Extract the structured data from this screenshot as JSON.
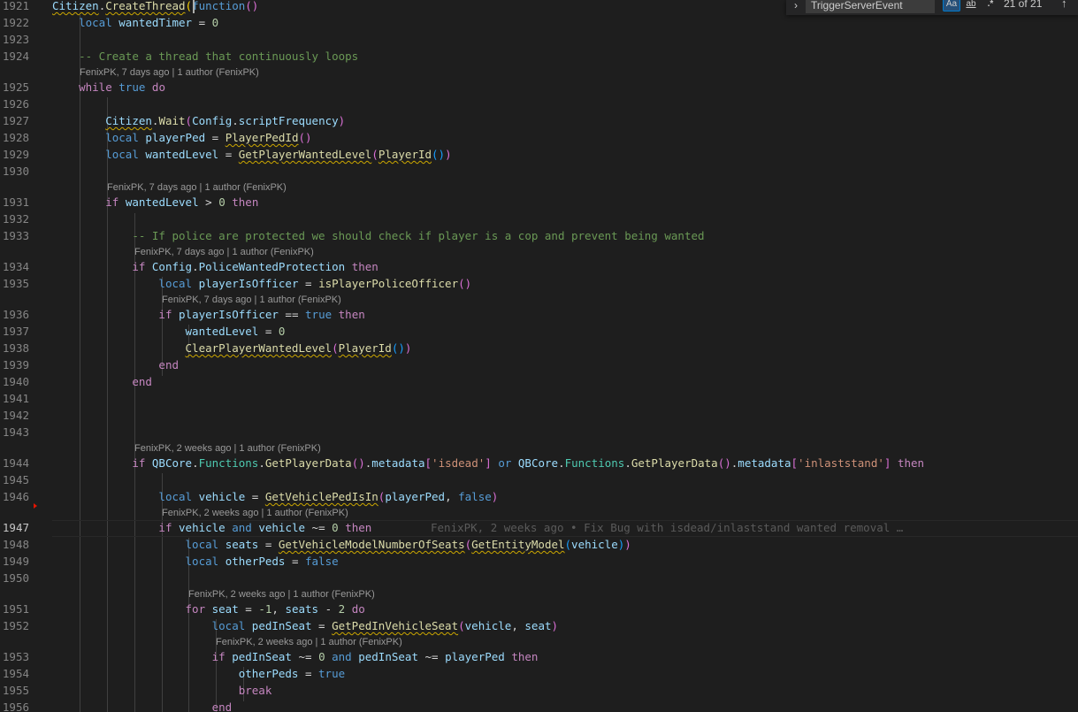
{
  "find_widget": {
    "toggle_icon": "chevron-right-icon",
    "query": "TriggerServerEvent",
    "match_case_label": "Aa",
    "whole_word_label": "ab",
    "regex_label": ".*",
    "count": "21 of 21",
    "prev_icon": "arrow-up-icon"
  },
  "code_lens": [
    "FenixPK, 7 days ago | 1 author (FenixPK)",
    "FenixPK, 7 days ago | 1 author (FenixPK)",
    "FenixPK, 7 days ago | 1 author (FenixPK)",
    "FenixPK, 7 days ago | 1 author (FenixPK)",
    "FenixPK, 2 weeks ago | 1 author (FenixPK)",
    "FenixPK, 2 weeks ago | 1 author (FenixPK)",
    "FenixPK, 2 weeks ago | 1 author (FenixPK)",
    "FenixPK, 2 weeks ago | 1 author (FenixPK)"
  ],
  "inline_blame": "FenixPK, 2 weeks ago • Fix Bug with isdead/inlaststand wanted removal …",
  "current_line": "1947",
  "lines": [
    {
      "n": "1921",
      "tokens": [
        [
          "Citizen",
          "var squig"
        ],
        [
          ".",
          ""
        ],
        [
          "CreateThread",
          "fn squig"
        ],
        [
          "(",
          "par1"
        ],
        [
          "function",
          "kw"
        ],
        [
          "()",
          "par2"
        ]
      ]
    },
    {
      "n": "1922",
      "tokens": [
        [
          "    ",
          ""
        ],
        [
          "local",
          "kw"
        ],
        [
          " ",
          ""
        ],
        [
          "wantedTimer",
          "var"
        ],
        [
          " = ",
          ""
        ],
        [
          "0",
          "num"
        ]
      ]
    },
    {
      "n": "1923",
      "tokens": []
    },
    {
      "n": "1924",
      "tokens": [
        [
          "    ",
          ""
        ],
        [
          "-- Create a thread that continuously loops",
          "cmt"
        ]
      ]
    },
    {
      "n": "1925",
      "tokens": [
        [
          "    ",
          ""
        ],
        [
          "while",
          "ctl"
        ],
        [
          " ",
          ""
        ],
        [
          "true",
          "kw"
        ],
        [
          " ",
          ""
        ],
        [
          "do",
          "ctl"
        ]
      ]
    },
    {
      "n": "1926",
      "tokens": []
    },
    {
      "n": "1927",
      "tokens": [
        [
          "        ",
          ""
        ],
        [
          "Citizen",
          "var squig"
        ],
        [
          ".",
          ""
        ],
        [
          "Wait",
          "fn"
        ],
        [
          "(",
          "par2"
        ],
        [
          "Config",
          "var"
        ],
        [
          ".",
          ""
        ],
        [
          "scriptFrequency",
          "var"
        ],
        [
          ")",
          "par2"
        ]
      ]
    },
    {
      "n": "1928",
      "tokens": [
        [
          "        ",
          ""
        ],
        [
          "local",
          "kw"
        ],
        [
          " ",
          ""
        ],
        [
          "playerPed",
          "var"
        ],
        [
          " = ",
          ""
        ],
        [
          "PlayerPedId",
          "fn squig"
        ],
        [
          "()",
          "par2"
        ]
      ]
    },
    {
      "n": "1929",
      "tokens": [
        [
          "        ",
          ""
        ],
        [
          "local",
          "kw"
        ],
        [
          " ",
          ""
        ],
        [
          "wantedLevel",
          "var"
        ],
        [
          " = ",
          ""
        ],
        [
          "GetPlayerWantedLevel",
          "fn squig"
        ],
        [
          "(",
          "par2"
        ],
        [
          "PlayerId",
          "fn squig"
        ],
        [
          "()",
          "par3"
        ],
        [
          ")",
          "par2"
        ]
      ]
    },
    {
      "n": "1930",
      "tokens": []
    },
    {
      "n": "1931",
      "tokens": [
        [
          "        ",
          ""
        ],
        [
          "if",
          "ctl"
        ],
        [
          " ",
          ""
        ],
        [
          "wantedLevel",
          "var"
        ],
        [
          " > ",
          ""
        ],
        [
          "0",
          "num"
        ],
        [
          " ",
          ""
        ],
        [
          "then",
          "ctl"
        ]
      ]
    },
    {
      "n": "1932",
      "tokens": []
    },
    {
      "n": "1933",
      "tokens": [
        [
          "            ",
          ""
        ],
        [
          "-- If police are protected we should check if player is a cop and prevent being wanted",
          "cmt"
        ]
      ]
    },
    {
      "n": "1934",
      "tokens": [
        [
          "            ",
          ""
        ],
        [
          "if",
          "ctl"
        ],
        [
          " ",
          ""
        ],
        [
          "Config",
          "var"
        ],
        [
          ".",
          ""
        ],
        [
          "PoliceWantedProtection",
          "var"
        ],
        [
          " ",
          ""
        ],
        [
          "then",
          "ctl"
        ]
      ]
    },
    {
      "n": "1935",
      "tokens": [
        [
          "                ",
          ""
        ],
        [
          "local",
          "kw"
        ],
        [
          " ",
          ""
        ],
        [
          "playerIsOfficer",
          "var"
        ],
        [
          " = ",
          ""
        ],
        [
          "isPlayerPoliceOfficer",
          "fn"
        ],
        [
          "()",
          "par2"
        ]
      ]
    },
    {
      "n": "1936",
      "tokens": [
        [
          "                ",
          ""
        ],
        [
          "if",
          "ctl"
        ],
        [
          " ",
          ""
        ],
        [
          "playerIsOfficer",
          "var"
        ],
        [
          " == ",
          ""
        ],
        [
          "true",
          "kw"
        ],
        [
          " ",
          ""
        ],
        [
          "then",
          "ctl"
        ]
      ]
    },
    {
      "n": "1937",
      "tokens": [
        [
          "                    ",
          ""
        ],
        [
          "wantedLevel",
          "var"
        ],
        [
          " = ",
          ""
        ],
        [
          "0",
          "num"
        ]
      ]
    },
    {
      "n": "1938",
      "tokens": [
        [
          "                    ",
          ""
        ],
        [
          "ClearPlayerWantedLevel",
          "fn squig"
        ],
        [
          "(",
          "par2"
        ],
        [
          "PlayerId",
          "fn squig"
        ],
        [
          "()",
          "par3"
        ],
        [
          ")",
          "par2"
        ]
      ]
    },
    {
      "n": "1939",
      "tokens": [
        [
          "                ",
          ""
        ],
        [
          "end",
          "ctl"
        ]
      ]
    },
    {
      "n": "1940",
      "tokens": [
        [
          "            ",
          ""
        ],
        [
          "end",
          "ctl"
        ]
      ]
    },
    {
      "n": "1941",
      "tokens": []
    },
    {
      "n": "1942",
      "tokens": []
    },
    {
      "n": "1943",
      "tokens": []
    },
    {
      "n": "1944",
      "tokens": [
        [
          "            ",
          ""
        ],
        [
          "if",
          "ctl"
        ],
        [
          " ",
          ""
        ],
        [
          "QBCore",
          "var"
        ],
        [
          ".",
          ""
        ],
        [
          "Functions",
          "tp"
        ],
        [
          ".",
          ""
        ],
        [
          "GetPlayerData",
          "fn"
        ],
        [
          "()",
          "par2"
        ],
        [
          ".",
          ""
        ],
        [
          "metadata",
          "var"
        ],
        [
          "[",
          "par2"
        ],
        [
          "'isdead'",
          "str"
        ],
        [
          "]",
          "par2"
        ],
        [
          " or ",
          "kw"
        ],
        [
          "QBCore",
          "var"
        ],
        [
          ".",
          ""
        ],
        [
          "Functions",
          "tp"
        ],
        [
          ".",
          ""
        ],
        [
          "GetPlayerData",
          "fn"
        ],
        [
          "()",
          "par2"
        ],
        [
          ".",
          ""
        ],
        [
          "metadata",
          "var"
        ],
        [
          "[",
          "par2"
        ],
        [
          "'inlaststand'",
          "str"
        ],
        [
          "]",
          "par2"
        ],
        [
          " ",
          ""
        ],
        [
          "then",
          "ctl"
        ]
      ]
    },
    {
      "n": "1945",
      "tokens": []
    },
    {
      "n": "1946",
      "tokens": [
        [
          "                ",
          ""
        ],
        [
          "local",
          "kw"
        ],
        [
          " ",
          ""
        ],
        [
          "vehicle",
          "var"
        ],
        [
          " = ",
          ""
        ],
        [
          "GetVehiclePedIsIn",
          "fn squig"
        ],
        [
          "(",
          "par2"
        ],
        [
          "playerPed",
          "var"
        ],
        [
          ", ",
          ""
        ],
        [
          "false",
          "kw"
        ],
        [
          ")",
          "par2"
        ]
      ]
    },
    {
      "n": "1947",
      "tokens": [
        [
          "                ",
          ""
        ],
        [
          "if",
          "ctl"
        ],
        [
          " ",
          ""
        ],
        [
          "vehicle",
          "var"
        ],
        [
          " and ",
          "kw"
        ],
        [
          "vehicle",
          "var"
        ],
        [
          " ~= ",
          ""
        ],
        [
          "0",
          "num"
        ],
        [
          " ",
          ""
        ],
        [
          "then",
          "ctl"
        ]
      ]
    },
    {
      "n": "1948",
      "tokens": [
        [
          "                    ",
          ""
        ],
        [
          "local",
          "kw"
        ],
        [
          " ",
          ""
        ],
        [
          "seats",
          "var"
        ],
        [
          " = ",
          ""
        ],
        [
          "GetVehicleModelNumberOfSeats",
          "fn squig"
        ],
        [
          "(",
          "par2"
        ],
        [
          "GetEntityModel",
          "fn squig"
        ],
        [
          "(",
          "par3"
        ],
        [
          "vehicle",
          "var"
        ],
        [
          ")",
          "par3"
        ],
        [
          ")",
          "par2"
        ]
      ]
    },
    {
      "n": "1949",
      "tokens": [
        [
          "                    ",
          ""
        ],
        [
          "local",
          "kw"
        ],
        [
          " ",
          ""
        ],
        [
          "otherPeds",
          "var"
        ],
        [
          " = ",
          ""
        ],
        [
          "false",
          "kw"
        ]
      ]
    },
    {
      "n": "1950",
      "tokens": []
    },
    {
      "n": "1951",
      "tokens": [
        [
          "                    ",
          ""
        ],
        [
          "for",
          "ctl"
        ],
        [
          " ",
          ""
        ],
        [
          "seat",
          "var"
        ],
        [
          " = ",
          ""
        ],
        [
          "-1",
          "num"
        ],
        [
          ", ",
          ""
        ],
        [
          "seats",
          "var"
        ],
        [
          " - ",
          ""
        ],
        [
          "2",
          "num"
        ],
        [
          " ",
          ""
        ],
        [
          "do",
          "ctl"
        ]
      ]
    },
    {
      "n": "1952",
      "tokens": [
        [
          "                        ",
          ""
        ],
        [
          "local",
          "kw"
        ],
        [
          " ",
          ""
        ],
        [
          "pedInSeat",
          "var"
        ],
        [
          " = ",
          ""
        ],
        [
          "GetPedInVehicleSeat",
          "fn squig"
        ],
        [
          "(",
          "par2"
        ],
        [
          "vehicle",
          "var"
        ],
        [
          ", ",
          ""
        ],
        [
          "seat",
          "var"
        ],
        [
          ")",
          "par2"
        ]
      ]
    },
    {
      "n": "1953",
      "tokens": [
        [
          "                        ",
          ""
        ],
        [
          "if",
          "ctl"
        ],
        [
          " ",
          ""
        ],
        [
          "pedInSeat",
          "var"
        ],
        [
          " ~= ",
          ""
        ],
        [
          "0",
          "num"
        ],
        [
          " and ",
          "kw"
        ],
        [
          "pedInSeat",
          "var"
        ],
        [
          " ~= ",
          ""
        ],
        [
          "playerPed",
          "var"
        ],
        [
          " ",
          ""
        ],
        [
          "then",
          "ctl"
        ]
      ]
    },
    {
      "n": "1954",
      "tokens": [
        [
          "                            ",
          ""
        ],
        [
          "otherPeds",
          "var"
        ],
        [
          " = ",
          ""
        ],
        [
          "true",
          "kw"
        ]
      ]
    },
    {
      "n": "1955",
      "tokens": [
        [
          "                            ",
          ""
        ],
        [
          "break",
          "ctl"
        ]
      ]
    },
    {
      "n": "1956",
      "tokens": [
        [
          "                        ",
          ""
        ],
        [
          "end",
          "ctl"
        ]
      ]
    }
  ]
}
